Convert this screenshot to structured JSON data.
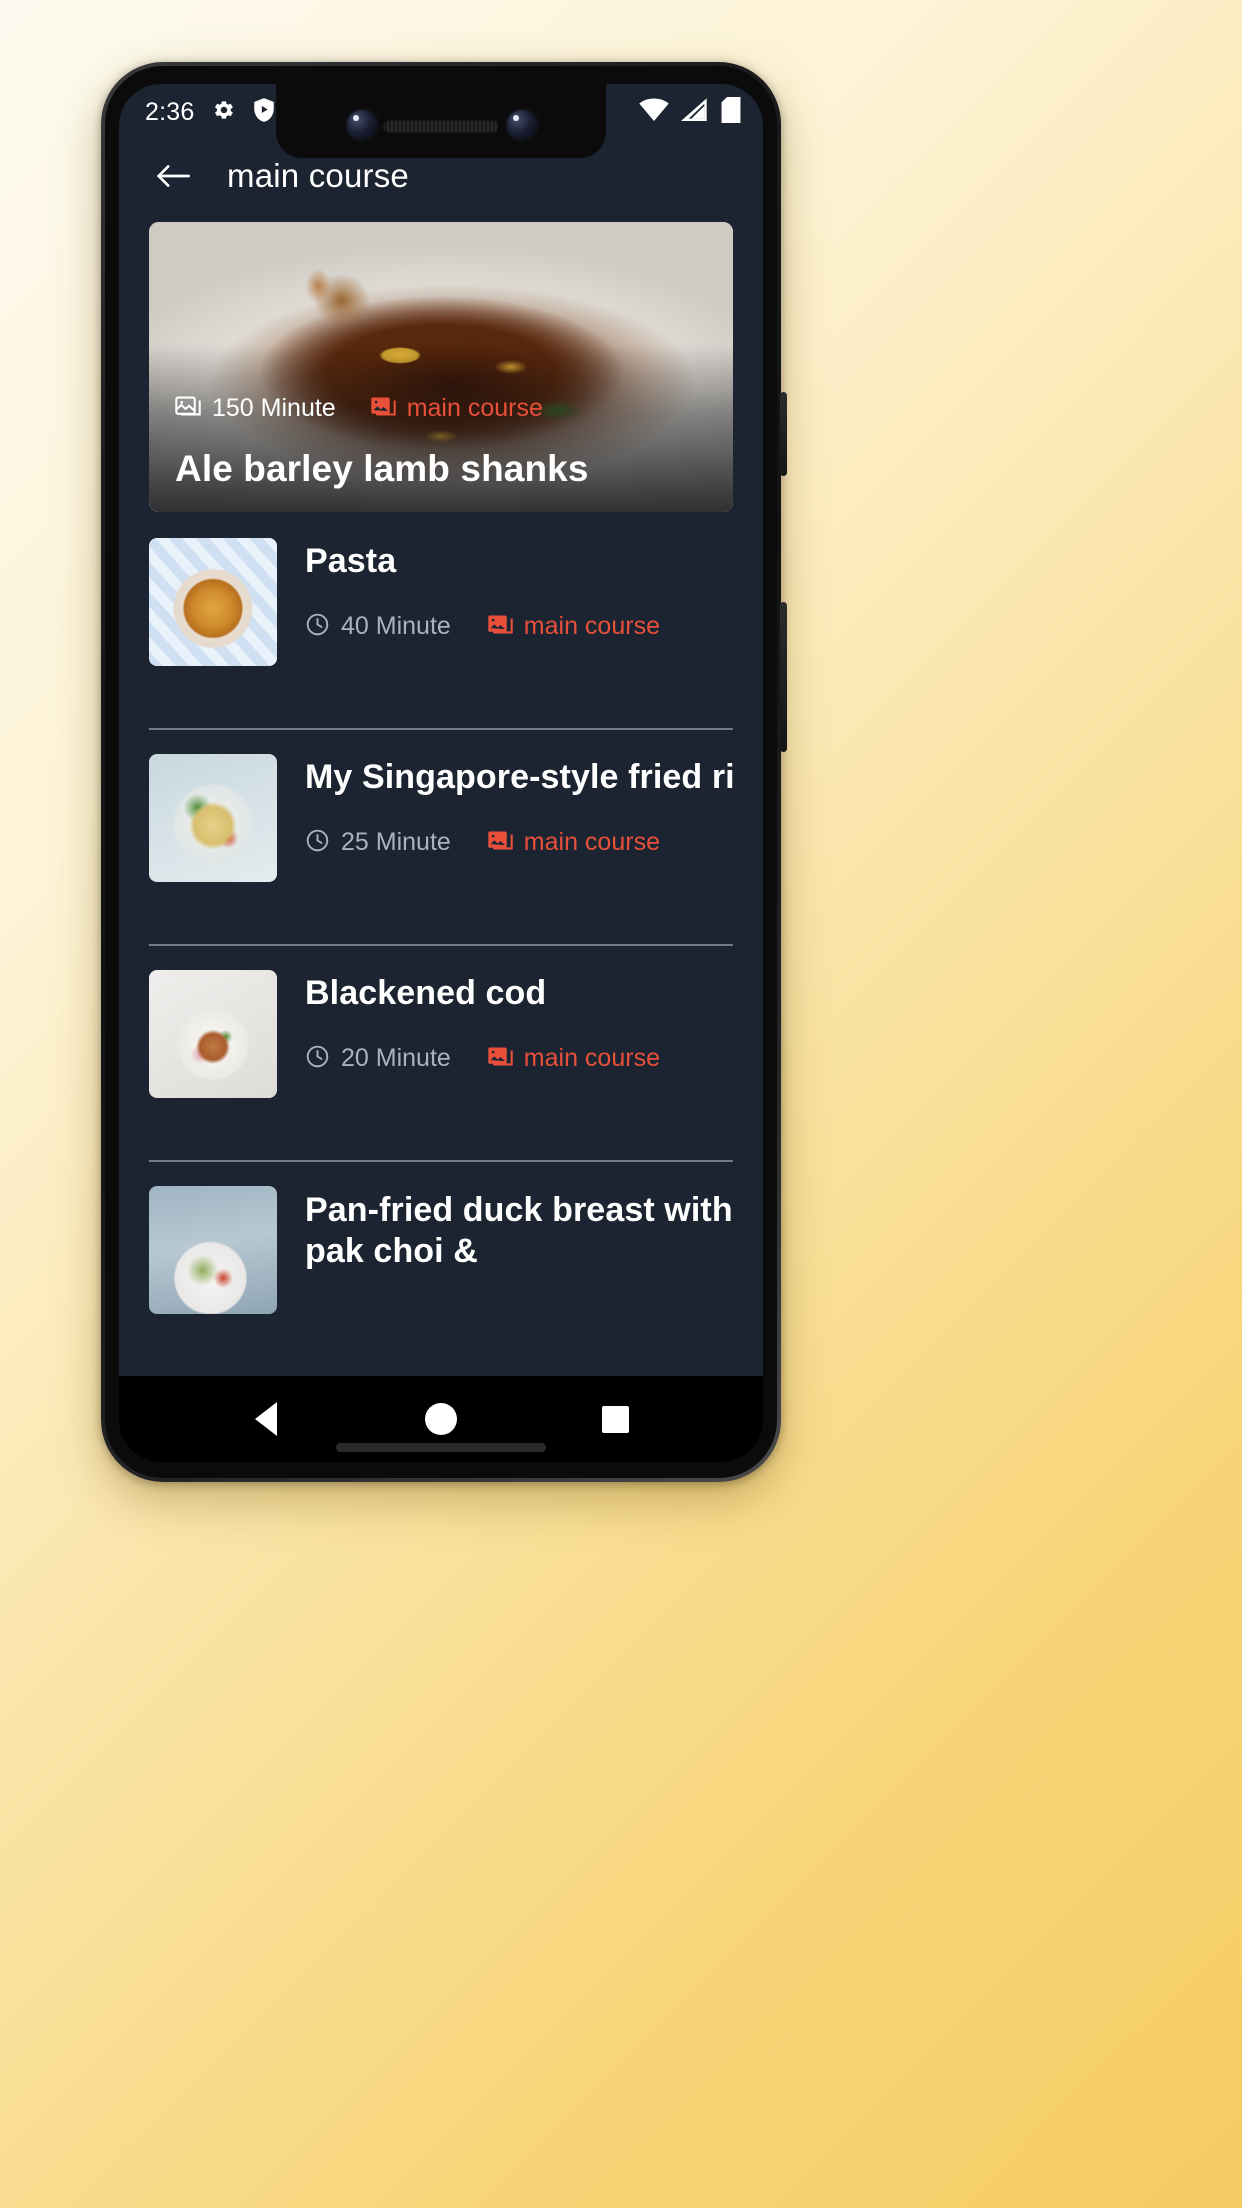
{
  "status_bar": {
    "time": "2:36",
    "left_icons": [
      "settings-gear-icon",
      "play-protect-shield-icon",
      "sd-card-icon"
    ],
    "right_icons": [
      "wifi-icon",
      "cell-signal-icon",
      "battery-icon"
    ]
  },
  "appbar": {
    "back_label": "back-arrow",
    "title": "main course"
  },
  "colors": {
    "background": "#1b2430",
    "accent": "#e8503a",
    "title_text": "#ffffff",
    "muted_text": "#a9b2bd",
    "divider": "#b9c2cc"
  },
  "hero": {
    "title": "Ale barley lamb shanks",
    "duration": "150 Minute",
    "duration_icon": "image-icon",
    "category": "main course",
    "category_icon": "image-icon",
    "photo": "roasted-lamb-shank-in-white-bowl"
  },
  "recipes": [
    {
      "title": "Pasta",
      "duration": "40 Minute",
      "duration_icon": "clock-icon",
      "category": "main course",
      "category_icon": "image-icon",
      "thumb": "pasta-on-blue-patterned-plate"
    },
    {
      "title": "My Singapore-style fried rice",
      "duration": "25 Minute",
      "duration_icon": "clock-icon",
      "category": "main course",
      "category_icon": "image-icon",
      "thumb": "fried-rice-with-lime-on-white-plate"
    },
    {
      "title": "Blackened cod",
      "duration": "20 Minute",
      "duration_icon": "clock-icon",
      "category": "main course",
      "category_icon": "image-icon",
      "thumb": "blackened-cod-on-white-plate"
    },
    {
      "title": "Pan-fried duck breast with pak choi &",
      "duration": "",
      "duration_icon": "clock-icon",
      "category": "",
      "category_icon": "image-icon",
      "thumb": "duck-breast-with-greens-on-plate"
    }
  ],
  "navbar": {
    "back": "back-triangle",
    "home": "home-circle",
    "recents": "recents-square"
  }
}
